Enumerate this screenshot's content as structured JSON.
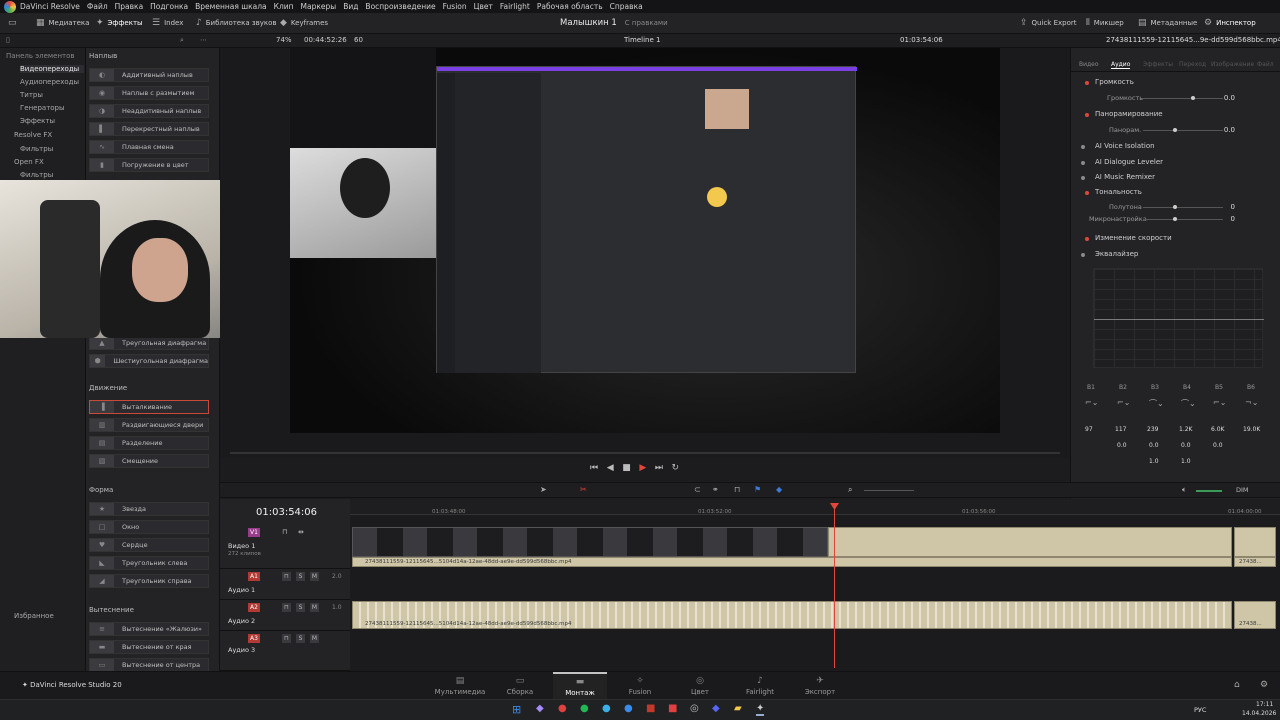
{
  "menubar": {
    "app": "DaVinci Resolve",
    "items": [
      "Файл",
      "Правка",
      "Подгонка",
      "Временная шкала",
      "Клип",
      "Маркеры",
      "Вид",
      "Воспроизведение",
      "Fusion",
      "Цвет",
      "Fairlight",
      "Рабочая область",
      "Справка"
    ]
  },
  "topbar": {
    "media": "Медиатека",
    "effects": "Эффекты",
    "index": "Index",
    "sound_library": "Библиотека звуков",
    "keyframes": "Keyframes",
    "project_title": "Малышкин 1",
    "project_state": "С правками",
    "quick_export": "Quick Export",
    "mixer": "Микшер",
    "metadata": "Метаданные",
    "inspector": "Инспектор"
  },
  "toolrow": {
    "zoom": "74%",
    "timecode_left": "00:44:52:26",
    "fps": "60",
    "timeline_name": "Timeline 1",
    "timecode_right": "01:03:54:06",
    "clip_name": "27438111559-12115645...9e-dd599d568bbc.mp4"
  },
  "leftpanel": {
    "header": "Панель элементов",
    "items": [
      "Видеопереходы",
      "Аудиопереходы",
      "Титры",
      "Генераторы",
      "Эффекты",
      "Resolve FX",
      "Фильтры",
      "Open FX",
      "Фильтры"
    ],
    "favorites": "Избранное"
  },
  "fxpanel": {
    "header_overlays": "Наплыв",
    "overlays": [
      "Аддитивный наплыв",
      "Наплыв с размытием",
      "Неаддитивный наплыв",
      "Перекрестный наплыв",
      "Плавная смена",
      "Погружение в цвет"
    ],
    "iris": [
      "Треугольная диафрагма",
      "Шестиугольная диафрагма"
    ],
    "header_motion": "Движение",
    "motion": [
      "Выталкивание",
      "Раздвигающиеся двери",
      "Разделение",
      "Смещение"
    ],
    "header_shape": "Форма",
    "shape": [
      "Звезда",
      "Окно",
      "Сердце",
      "Треугольник слева",
      "Треугольник справа"
    ],
    "header_wipe": "Вытеснение",
    "wipe": [
      "Вытеснение «Жалюзи»",
      "Вытеснение от края",
      "Вытеснение от центра"
    ]
  },
  "inspector": {
    "tabs": [
      "Видео",
      "Аудио",
      "Эффекты",
      "Переход",
      "Изображение",
      "Файл"
    ],
    "volume": "Громкость",
    "volume_sub": "Громкость",
    "volume_val": "0.0",
    "pan": "Панорамирование",
    "pan_sub": "Панорам.",
    "pan_val": "0.0",
    "voice_iso": "AI Voice Isolation",
    "dialogue": "AI Dialogue Leveler",
    "music": "AI Music Remixer",
    "pitch": "Тональность",
    "semitones": "Полутона",
    "semitones_val": "0",
    "cents": "Микронастройка",
    "cents_val": "0",
    "speed": "Изменение скорости",
    "eq": "Эквалайзер",
    "bands": [
      "B1",
      "B2",
      "B3",
      "B4",
      "B5",
      "B6"
    ],
    "freqs": [
      "97",
      "117",
      "239",
      "1.2K",
      "6.0K",
      "19.0K"
    ],
    "gains": [
      "0.0",
      "0.0",
      "0.0",
      "0.0"
    ],
    "q": [
      "1.0",
      "1.0"
    ]
  },
  "timeline": {
    "timecode": "01:03:54:06",
    "ruler": [
      "01:03:48:00",
      "01:03:52:00",
      "01:03:56:00",
      "01:04:00:00"
    ],
    "tracks": [
      {
        "tag": "V1",
        "name": "Видео 1",
        "sub": "272 клипов"
      },
      {
        "tag": "A1",
        "name": "Аудио 1",
        "level": "2.0"
      },
      {
        "tag": "A2",
        "name": "Аудио 2",
        "level": "1.0"
      },
      {
        "tag": "A3",
        "name": "Аудио 3",
        "level": ""
      }
    ],
    "clip_label": "27438111559-12115645...5104d14a-12ae-48dd-ae9e-dd599d568bbc.mp4",
    "clip_label_short": "27438...",
    "dim": "DIM"
  },
  "bottombar": {
    "brand": "DaVinci Resolve Studio 20",
    "pages": [
      "Мультимедиа",
      "Сборка",
      "Монтаж",
      "Fusion",
      "Цвет",
      "Fairlight",
      "Экспорт"
    ]
  },
  "taskbar": {
    "lang": "РУС",
    "time": "17:11",
    "date": "14.04.2026"
  },
  "colors": {
    "accent": "#c94a3b",
    "playhead": "#e0463a",
    "audio_clip": "#cfc6a8"
  }
}
